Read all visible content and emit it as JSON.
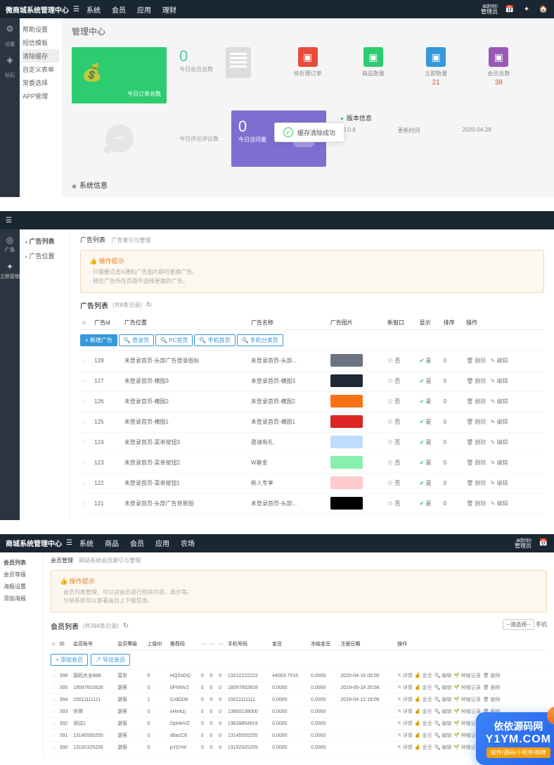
{
  "p1": {
    "brand": "微商城系统管理中心",
    "nav": [
      "系统",
      "会员",
      "应用",
      "理财"
    ],
    "admin_name": "admin",
    "admin_role": "管理员",
    "side_icons": [
      {
        "icon": "gear",
        "label": "设置"
      },
      {
        "icon": "diamond",
        "label": "钻石"
      }
    ],
    "sidemenu": [
      "帮助设置",
      "短信模板",
      "清除缓存",
      "自定义表单",
      "常委选择",
      "APP管理"
    ],
    "sidemenu_active_idx": 2,
    "title": "管理中心",
    "card_green_label": "今日订单总数",
    "counter1": {
      "num": "0",
      "label": "今日会员总数"
    },
    "counter2": {
      "num": "0",
      "label": "今日访问量"
    },
    "bubble_label": "今日评论评论数",
    "stats": [
      {
        "color": "#e74c3c",
        "label": "待处理订单",
        "val": ""
      },
      {
        "color": "#2ecc71",
        "label": "商品数量",
        "val": ""
      },
      {
        "color": "#3498db",
        "label": "立即数量",
        "val": "21"
      },
      {
        "color": "#9b59b6",
        "label": "会员总数",
        "val": "38"
      }
    ],
    "version": {
      "title": "版本信息",
      "rows": [
        {
          "k": "",
          "v": "v2.0.8"
        },
        {
          "k": "更新时间",
          "v": "2020-04-29"
        }
      ]
    },
    "toast": "缓存清除成功",
    "sysinfo": "系统信息"
  },
  "p2": {
    "side": [
      {
        "icon": "◎",
        "label": "广告"
      },
      {
        "icon": "✦",
        "label": "立即营销"
      }
    ],
    "menu": [
      "广告列表",
      "广告位置"
    ],
    "crumb_title": "广告列表",
    "crumb_sub": "广告索引与管理",
    "tip_title": "操作提示",
    "tips": [
      "只需要点击X通知广告图片即可更换广告。",
      "预览广告所在页面中选择更换的广告。"
    ],
    "list_title": "广告列表",
    "list_count": "(共8条记录)",
    "buttons": [
      "+ 新增广告",
      "登录页",
      "PC首页",
      "手机首页",
      "手机分类页"
    ],
    "cols": [
      "",
      "广告id",
      "广告位置",
      "广告名称",
      "广告图片",
      "新窗口",
      "显示",
      "排序",
      "操作"
    ],
    "rows": [
      {
        "id": "128",
        "pos": "未登录首页-头部广告登录图标",
        "name": "未登录首页-头部...",
        "img": "#6b7280",
        "win": false,
        "show": true,
        "sort": "0"
      },
      {
        "id": "127",
        "pos": "未登录首页-横图3",
        "name": "未登录首页-横图3",
        "img": "#1f2937",
        "win": false,
        "show": true,
        "sort": "0"
      },
      {
        "id": "126",
        "pos": "未登录首页-横图2",
        "name": "未登录首页-横图2",
        "img": "#f97316",
        "win": false,
        "show": true,
        "sort": "0"
      },
      {
        "id": "125",
        "pos": "未登录首页-横图1",
        "name": "未登录首页-横图1",
        "img": "#dc2626",
        "win": false,
        "show": true,
        "sort": "0"
      },
      {
        "id": "124",
        "pos": "未登录首页-菜单按钮3",
        "name": "邀请有礼",
        "img": "#bfdbfe",
        "win": false,
        "show": true,
        "sort": "0"
      },
      {
        "id": "123",
        "pos": "未登录首页-菜单按钮2",
        "name": "W基金",
        "img": "#86efac",
        "win": false,
        "show": true,
        "sort": "0"
      },
      {
        "id": "122",
        "pos": "未登录首页-菜单按钮1",
        "name": "新人专享",
        "img": "#fecaca",
        "win": false,
        "show": true,
        "sort": "0"
      },
      {
        "id": "121",
        "pos": "未登录首页-头部广告背景图",
        "name": "未登录首页-头部...",
        "img": "#000000",
        "win": false,
        "show": true,
        "sort": "0"
      }
    ],
    "op_del": "删除",
    "op_edit": "编辑",
    "show_yes": "是",
    "show_no": "否"
  },
  "p3": {
    "brand": "商城系统管理中心",
    "nav": [
      "系统",
      "商品",
      "会员",
      "应用",
      "农场"
    ],
    "admin_name": "admin",
    "admin_role": "管理员",
    "menu": [
      "会员列表",
      "会员等级",
      "海报设置",
      "添加海报"
    ],
    "crumb_title": "会员管理",
    "crumb_sub": "网站系统会员索引与管理",
    "tip_title": "操作提示",
    "tips": [
      "会员列表管理，可以对会员进行相关内容，展示等。",
      "分销系统可以查看会员上下级信息。"
    ],
    "list_title": "会员列表",
    "list_count": "(共394条记录)",
    "filter_sel": "--请选择--",
    "filter_txt": "手机",
    "btn_add": "+ 添加会员",
    "btn_export": "↗ 导出会员",
    "cols": [
      "",
      "ID",
      "会员账号",
      "会员等级",
      "上级ID",
      "推荐码",
      "···",
      "···",
      "···",
      "手机号码",
      "金豆",
      "冻结金豆",
      "注册日期",
      "操作"
    ],
    "rows": [
      {
        "id": "396",
        "acc": "源码大全888",
        "lvl": "富农",
        "pid": "0",
        "code": "HQZoDQ",
        "c1": "0",
        "c2": "0",
        "c3": "0",
        "phone": "13222222222",
        "bal": "44003.7516",
        "frz": "0.0000",
        "date": "2020-04-16 00:00"
      },
      {
        "id": "395",
        "acc": "18597602828",
        "lvl": "游客",
        "pid": "0",
        "code": "0FNNV2",
        "c1": "0",
        "c2": "0",
        "c3": "0",
        "phone": "18597602828",
        "bal": "0.0000",
        "frz": "0.0000",
        "date": "2019-09-18 20:58"
      },
      {
        "id": "394",
        "acc": "15011111111",
        "lvl": "游客",
        "pid": "1",
        "code": "CrdGDb",
        "c1": "0",
        "c2": "0",
        "c3": "0",
        "phone": "15011111111",
        "bal": "0.0000",
        "frz": "0.0000",
        "date": "2019-04-12 19:06"
      },
      {
        "id": "393",
        "acc": "帅哥",
        "lvl": "游客",
        "pid": "0",
        "code": "xHeAzj",
        "c1": "0",
        "c2": "0",
        "c3": "0",
        "phone": "13800138000",
        "bal": "0.0000",
        "frz": "0.0000",
        "date": ""
      },
      {
        "id": "392",
        "acc": "测试1",
        "lvl": "游客",
        "pid": "0",
        "code": "DpHwVZ",
        "c1": "0",
        "c2": "0",
        "c3": "0",
        "phone": "13628854919",
        "bal": "0.0000",
        "frz": "0.0000",
        "date": ""
      },
      {
        "id": "391",
        "acc": "13145555255",
        "lvl": "游客",
        "pid": "0",
        "code": "d6acC6",
        "c1": "0",
        "c2": "0",
        "c3": "0",
        "phone": "13145555255",
        "bal": "0.0000",
        "frz": "0.0000",
        "date": ""
      },
      {
        "id": "390",
        "acc": "13192325255",
        "lvl": "游客",
        "pid": "0",
        "code": "pYDYol",
        "c1": "0",
        "c2": "0",
        "c3": "0",
        "phone": "13192325255",
        "bal": "0.0000",
        "frz": "0.0000",
        "date": ""
      }
    ],
    "ops": [
      "详情",
      "金豆",
      "编辑",
      "种植记录",
      "删除"
    ],
    "wm": {
      "cn": "依依源码网",
      "en": "Y1YM.COM",
      "tag": "软件/源码/小程序/棋牌"
    }
  }
}
